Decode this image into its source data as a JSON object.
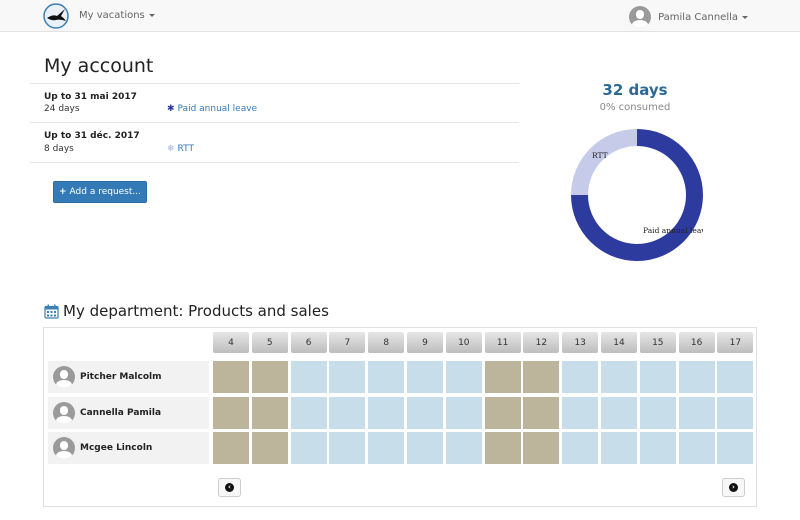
{
  "nav": {
    "menu_label": "My vacations",
    "user_name": "Pamila Cannella"
  },
  "account": {
    "title": "My account",
    "periods": [
      {
        "title": "Up to 31 mai 2017",
        "days": "24 days",
        "type": "Paid annual leave",
        "icon": "asterisk-icon",
        "color": "#2e3b9e"
      },
      {
        "title": "Up to 31 déc. 2017",
        "days": "8 days",
        "type": "RTT",
        "icon": "snowflake-icon",
        "color": "#c5cbe8"
      }
    ],
    "add_button": "Add a request..."
  },
  "summary": {
    "total": "32 days",
    "consumed": "0% consumed"
  },
  "chart_data": {
    "type": "pie",
    "categories": [
      "Paid annual leave",
      "RTT"
    ],
    "values": [
      24,
      8
    ],
    "colors": [
      "#2e3b9e",
      "#c5cbe8"
    ],
    "donut": true
  },
  "department": {
    "title": "My department: Products and sales",
    "days": [
      "4",
      "5",
      "6",
      "7",
      "8",
      "9",
      "10",
      "11",
      "12",
      "13",
      "14",
      "15",
      "16",
      "17"
    ],
    "people": [
      {
        "name": "Pitcher Malcolm",
        "cells": [
          "off",
          "off",
          "work",
          "work",
          "work",
          "work",
          "work",
          "off",
          "off",
          "work",
          "work",
          "work",
          "work",
          "work"
        ]
      },
      {
        "name": "Cannella Pamila",
        "cells": [
          "off",
          "off",
          "work",
          "work",
          "work",
          "work",
          "work",
          "off",
          "off",
          "work",
          "work",
          "work",
          "work",
          "work"
        ]
      },
      {
        "name": "Mcgee Lincoln",
        "cells": [
          "off",
          "off",
          "work",
          "work",
          "work",
          "work",
          "work",
          "off",
          "off",
          "work",
          "work",
          "work",
          "work",
          "work"
        ]
      }
    ]
  }
}
